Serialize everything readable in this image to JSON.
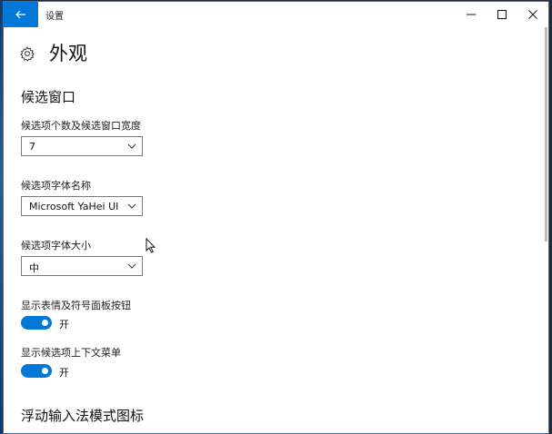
{
  "titlebar": {
    "app_title": "设置",
    "back_icon": "arrow-left-icon",
    "minimize_icon": "minimize-icon",
    "maximize_icon": "maximize-icon",
    "close_icon": "close-icon"
  },
  "header": {
    "icon": "gear-icon",
    "title": "外观"
  },
  "candidate_window": {
    "section_title": "候选窗口",
    "count_and_width": {
      "label": "候选项个数及候选窗口宽度",
      "value": "7"
    },
    "font_name": {
      "label": "候选项字体名称",
      "value": "Microsoft YaHei UI"
    },
    "font_size": {
      "label": "候选项字体大小",
      "value": "中"
    },
    "emoji_button": {
      "label": "显示表情及符号面板按钮",
      "state": "开",
      "on": true
    },
    "context_menu": {
      "label": "显示候选项上下文菜单",
      "state": "开",
      "on": true
    }
  },
  "floating_mode_icon": {
    "section_title": "浮动输入法模式图标"
  },
  "colors": {
    "accent": "#0078d7",
    "text": "#111111"
  }
}
